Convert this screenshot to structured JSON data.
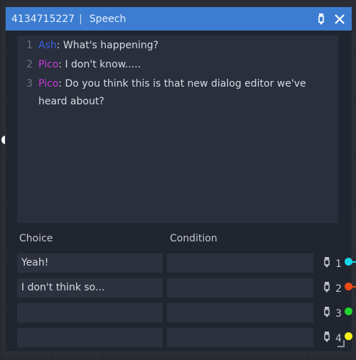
{
  "node": {
    "id": "4134715227",
    "separator": "|",
    "type": "Speech",
    "edit_icon": "pencil-icon",
    "close_icon": "close-icon"
  },
  "dialog": {
    "lines": [
      {
        "num": "1",
        "speaker": "Ash",
        "speaker_color": "#3b5fe0",
        "text": ": What's happening?"
      },
      {
        "num": "2",
        "speaker": "Pico",
        "speaker_color": "#c93ad6",
        "text": ": I don't know....."
      },
      {
        "num": "3",
        "speaker": "Pico",
        "speaker_color": "#c93ad6",
        "text": ": Do you think this is that new dialog editor we've heard about?"
      }
    ]
  },
  "headers": {
    "choice": "Choice",
    "condition": "Condition"
  },
  "choices": [
    {
      "text": "Yeah!",
      "condition": "",
      "num": "1",
      "port_color": "#16d6ea"
    },
    {
      "text": "I don't think so...",
      "condition": "",
      "num": "2",
      "port_color": "#ee4a17"
    },
    {
      "text": "",
      "condition": "",
      "num": "3",
      "port_color": "#20d62e"
    },
    {
      "text": "",
      "condition": "",
      "num": "4",
      "port_color": "#f5f21b"
    }
  ]
}
